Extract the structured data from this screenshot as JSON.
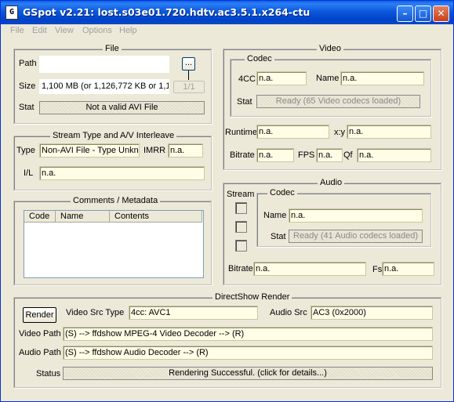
{
  "window": {
    "title": "GSpot v2.21: lost.s03e01.720.hdtv.ac3.5.1.x264-ctu",
    "icon": "app-icon",
    "controls": [
      "minimize",
      "maximize",
      "close"
    ]
  },
  "menu": [
    "File",
    "Edit",
    "View",
    "Options",
    "Help"
  ],
  "file": {
    "title": "File",
    "path_label": "Path",
    "path_value": "",
    "browse_label": "...",
    "size_label": "Size",
    "size_value": "1,100 MB (or 1,126,772 KB or 1,1",
    "page_label": "1/1",
    "stat_label": "Stat",
    "stat_value": "Not a valid AVI File"
  },
  "stream": {
    "title": "Stream Type and A/V Interleave",
    "type_label": "Type",
    "type_value": "Non-AVI File - Type Unkn",
    "imrr_label": "IMRR",
    "imrr_value": "n.a.",
    "il_label": "I/L",
    "il_value": "n.a."
  },
  "comments": {
    "title": "Comments / Metadata",
    "columns": [
      "Code",
      "Name",
      "Contents"
    ]
  },
  "video": {
    "title": "Video",
    "codec_title": "Codec",
    "fourcc_label": "4CC",
    "fourcc_value": "n.a.",
    "name_label": "Name",
    "name_value": "n.a.",
    "stat_label": "Stat",
    "stat_value": "Ready (65 Video codecs loaded)",
    "runtime_label": "Runtime",
    "runtime_value": "n.a.",
    "xy_label": "x:y",
    "xy_value": "n.a.",
    "bitrate_label": "Bitrate",
    "bitrate_value": "n.a.",
    "fps_label": "FPS",
    "fps_value": "n.a.",
    "qf_label": "Qf",
    "qf_value": "n.a."
  },
  "audio": {
    "title": "Audio",
    "stream_label": "Stream",
    "codec_title": "Codec",
    "name_label": "Name",
    "name_value": "n.a.",
    "stat_label": "Stat",
    "stat_value": "Ready (41 Audio codecs loaded)",
    "bitrate_label": "Bitrate",
    "bitrate_value": "n.a.",
    "fs_label": "Fs",
    "fs_value": "n.a."
  },
  "directshow": {
    "title": "DirectShow Render",
    "render_label": "Render",
    "video_src_type_label": "Video Src Type",
    "video_src_type_value": "4cc: AVC1",
    "audio_src_label": "Audio Src",
    "audio_src_value": "AC3 (0x2000)",
    "video_path_label": "Video Path",
    "video_path_value": "(S) --> ffdshow MPEG-4 Video Decoder --> (R)",
    "audio_path_label": "Audio Path",
    "audio_path_value": "(S) --> ffdshow Audio Decoder --> (R)",
    "status_label": "Status",
    "status_value": "Rendering Successful.  (click for details...)"
  }
}
